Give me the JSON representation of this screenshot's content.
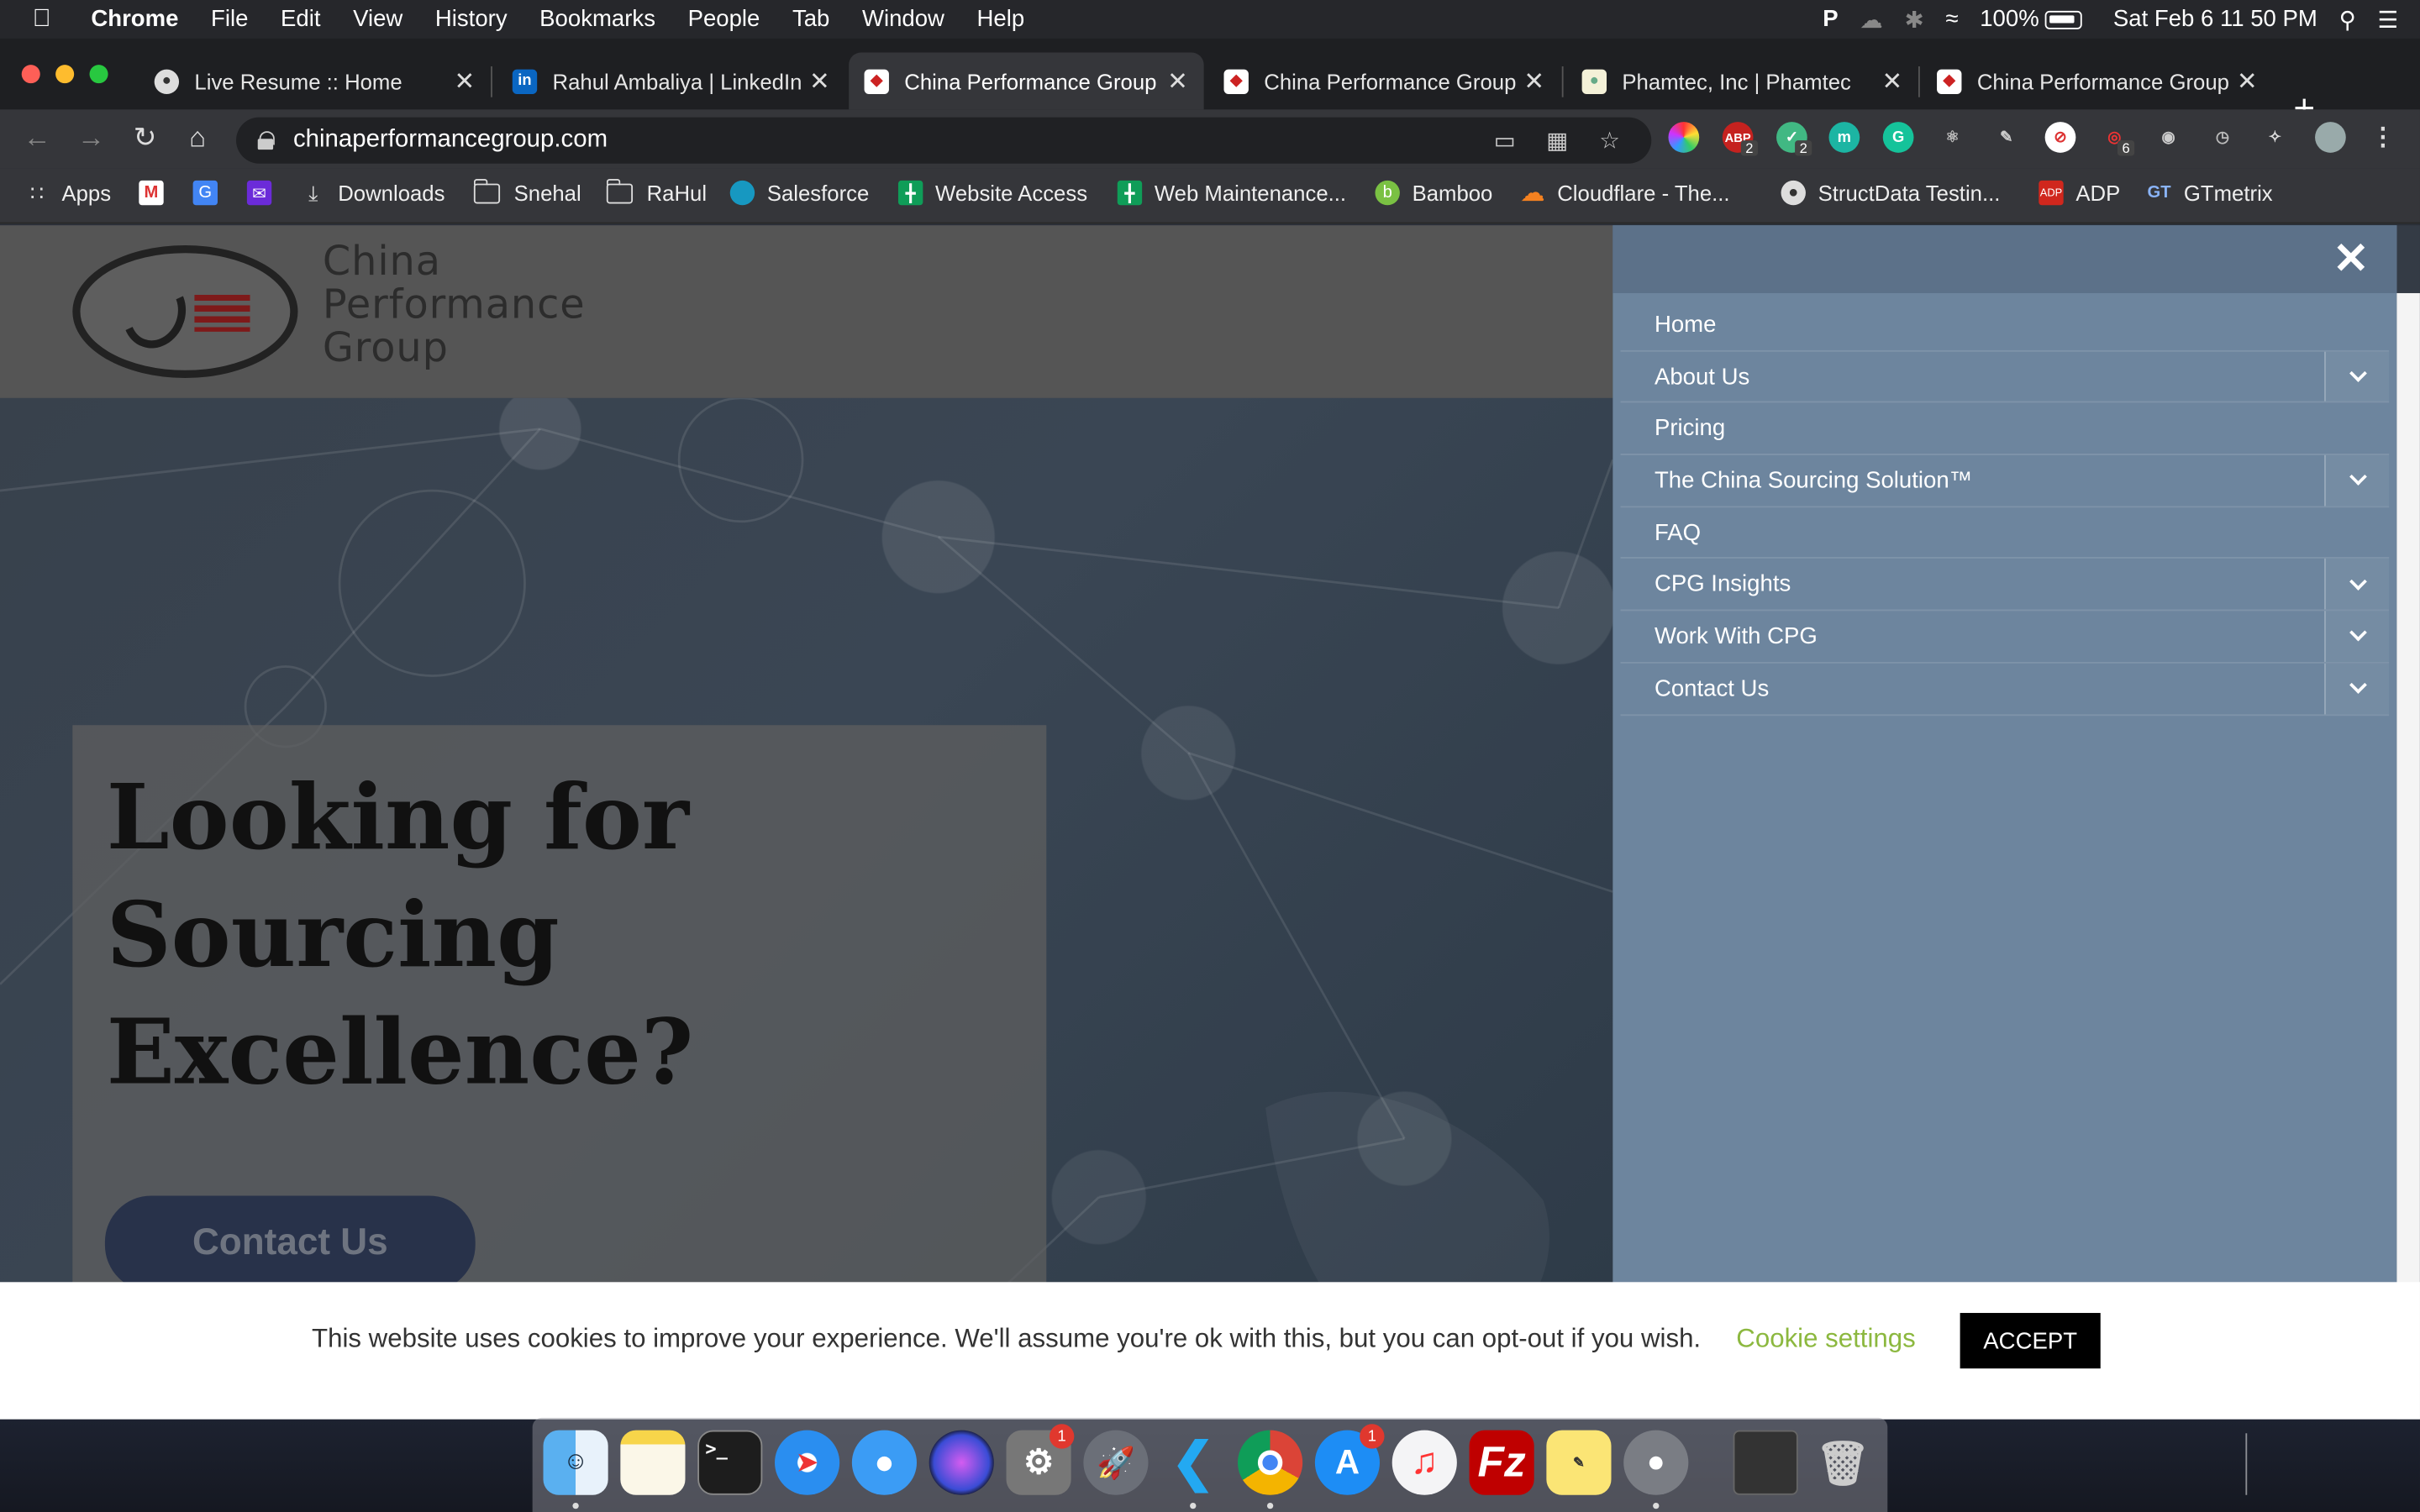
{
  "menubar": {
    "app_name": "Chrome",
    "items": [
      "File",
      "Edit",
      "View",
      "History",
      "Bookmarks",
      "People",
      "Tab",
      "Window",
      "Help"
    ],
    "battery": "100%",
    "datetime": "Sat Feb 6  11 50 PM"
  },
  "tabs": [
    {
      "title": "Live Resume :: Home",
      "favicon": "resume-icon"
    },
    {
      "title": "Rahul Ambaliya | LinkedIn",
      "favicon": "linkedin-icon"
    },
    {
      "title": "China Performance Group",
      "favicon": "cpg-icon",
      "active": true
    },
    {
      "title": "China Performance Group",
      "favicon": "cpg-icon"
    },
    {
      "title": "Phamtec, Inc | Phamtec",
      "favicon": "phamtec-icon"
    },
    {
      "title": "China Performance Group",
      "favicon": "cpg-icon"
    }
  ],
  "toolbar": {
    "url": "chinaperformancegroup.com",
    "extension_badges": {
      "abp": "2",
      "vue": "2",
      "lighthouse": "6"
    }
  },
  "bookmarks": [
    {
      "label": "Apps",
      "icon": "apps-grid-icon"
    },
    {
      "label": "",
      "icon": "gmail-icon"
    },
    {
      "label": "",
      "icon": "translate-icon"
    },
    {
      "label": "",
      "icon": "mail-icon"
    },
    {
      "label": "Downloads",
      "icon": "download-icon"
    },
    {
      "label": "Snehal",
      "icon": "folder-icon"
    },
    {
      "label": "RaHul",
      "icon": "folder-icon"
    },
    {
      "label": "Salesforce",
      "icon": "salesforce-icon"
    },
    {
      "label": "Website Access",
      "icon": "sheets-icon"
    },
    {
      "label": "Web Maintenance...",
      "icon": "sheets-icon"
    },
    {
      "label": "Bamboo",
      "icon": "bamboo-icon"
    },
    {
      "label": "Cloudflare - The...",
      "icon": "cloudflare-icon"
    },
    {
      "label": "StructData Testin...",
      "icon": "globe-icon"
    },
    {
      "label": "ADP",
      "icon": "adp-icon"
    },
    {
      "label": "GTmetrix",
      "icon": "gtmetrix-icon"
    }
  ],
  "site": {
    "logo_lines": [
      "China",
      "Performance",
      "Group"
    ],
    "hero_title": "Looking for Sourcing Excellence?",
    "hero_button": "Contact Us"
  },
  "side_menu": {
    "items": [
      {
        "label": "Home",
        "has_submenu": false
      },
      {
        "label": "About Us",
        "has_submenu": true
      },
      {
        "label": "Pricing",
        "has_submenu": false
      },
      {
        "label": "The China Sourcing Solution™",
        "has_submenu": true
      },
      {
        "label": "FAQ",
        "has_submenu": false
      },
      {
        "label": "CPG Insights",
        "has_submenu": true
      },
      {
        "label": "Work With CPG",
        "has_submenu": true
      },
      {
        "label": "Contact Us",
        "has_submenu": true
      }
    ]
  },
  "cookie": {
    "message": "This website uses cookies to improve your experience. We'll assume you're ok with this, but you can opt-out if you wish.",
    "settings_label": "Cookie settings",
    "accept_label": "ACCEPT"
  },
  "dock": {
    "apps": [
      "finder",
      "notes",
      "terminal",
      "safari",
      "messages",
      "siri",
      "system-preferences",
      "rocket-typist",
      "vscode",
      "chrome",
      "app-store",
      "music",
      "filezilla",
      "stickies",
      "sequel-pro",
      "screenshot",
      "trash"
    ],
    "badges": {
      "system-preferences": "1",
      "app-store": "1"
    }
  },
  "colors": {
    "menu_panel": "#6d859e",
    "cookie_link": "#8cb83f",
    "accept_bg": "#000000"
  }
}
